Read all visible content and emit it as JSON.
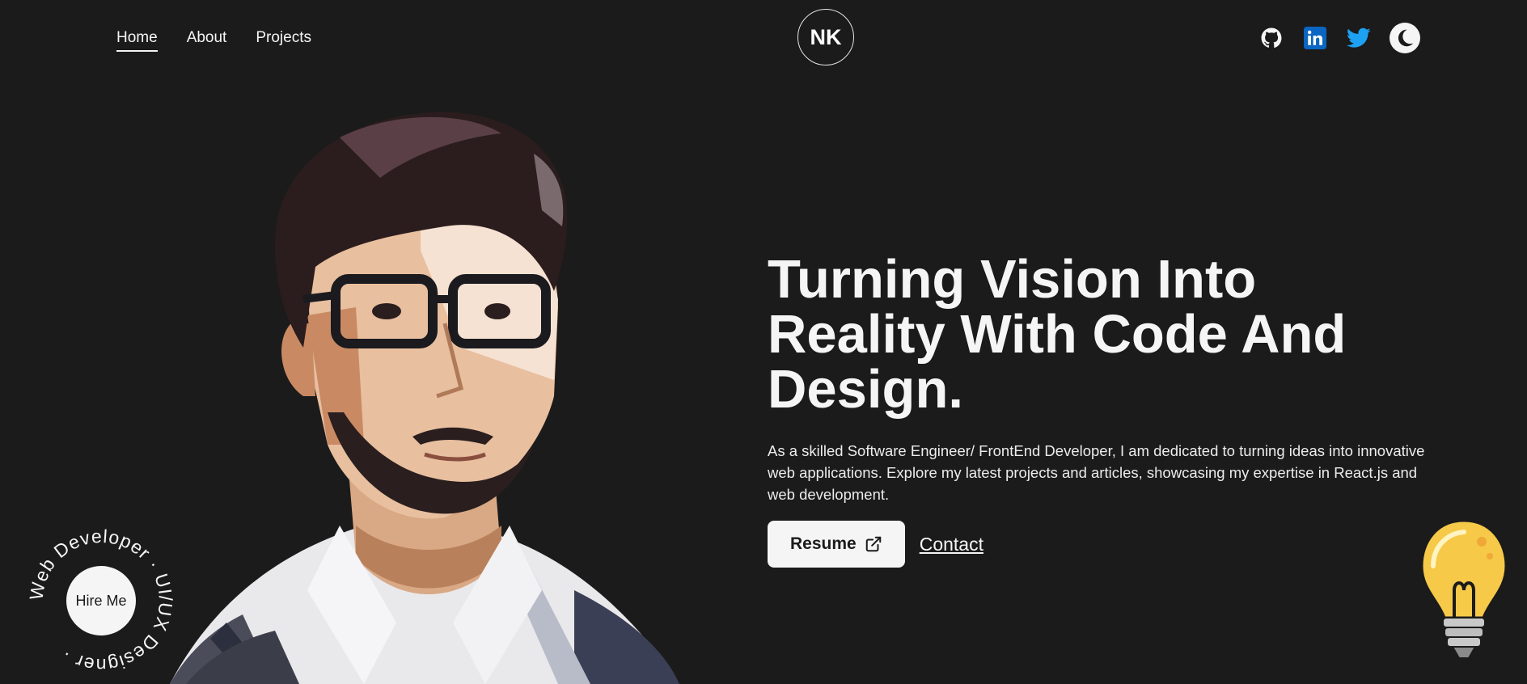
{
  "nav": {
    "links": [
      {
        "label": "Home",
        "active": true
      },
      {
        "label": "About",
        "active": false
      },
      {
        "label": "Projects",
        "active": false
      }
    ]
  },
  "logo": {
    "text": "NK"
  },
  "social": {
    "icons": [
      "github-icon",
      "linkedin-icon",
      "twitter-icon",
      "moon-icon"
    ],
    "linkedin_color": "#0a66c2",
    "twitter_color": "#1da1f2"
  },
  "hero": {
    "title": "Turning Vision Into Reality With Code And Design.",
    "description": "As a skilled Software Engineer/ FrontEnd Developer, I am dedicated to turning ideas into innovative web applications. Explore my latest projects and articles, showcasing my expertise in React.js and web development.",
    "resume_label": "Resume",
    "contact_label": "Contact"
  },
  "hire": {
    "button_label": "Hire Me",
    "ring_text": "Web Developer · UI/UX Designer ·"
  },
  "colors": {
    "background": "#1b1b1b",
    "foreground": "#f5f5f5",
    "bulb": "#f7c948"
  }
}
